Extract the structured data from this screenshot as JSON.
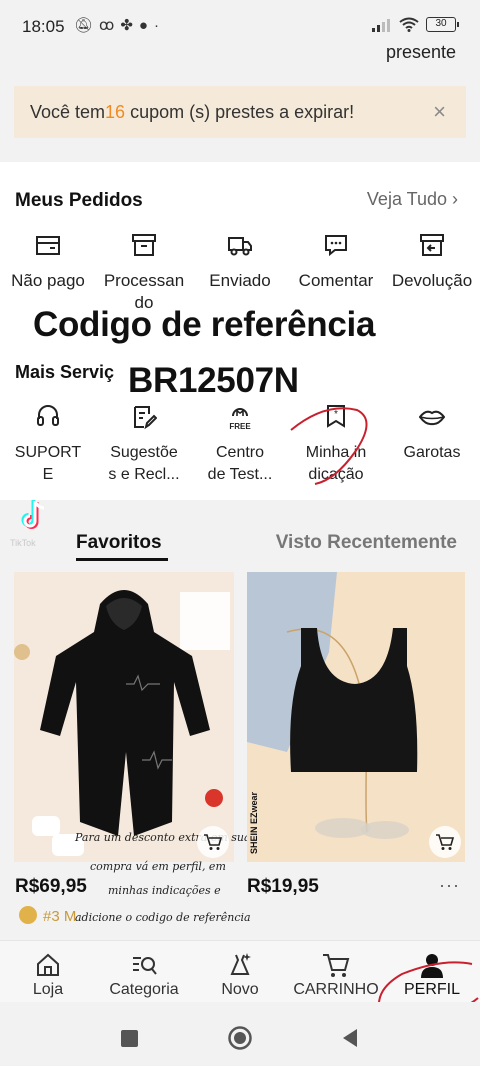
{
  "status_bar": {
    "time": "18:05",
    "icons": [
      "mute-icon",
      "voicemail-icon",
      "pinwheel-icon",
      "check-circle-icon",
      "dot-icon"
    ],
    "battery": "30",
    "top_link": "presente"
  },
  "coupon_banner": {
    "text_before": "Você tem",
    "count": "16",
    "text_after": " cupom (s) prestes a expirar!",
    "close": "×"
  },
  "orders": {
    "title": "Meus Pedidos",
    "see_all": "Veja Tudo",
    "items": [
      {
        "label": "Não pago",
        "icon": "wallet-icon"
      },
      {
        "label": "Processan do",
        "icon": "box-icon"
      },
      {
        "label": "Enviado",
        "icon": "truck-icon"
      },
      {
        "label": "Comentar",
        "icon": "comment-icon"
      },
      {
        "label": "Devolução",
        "icon": "return-icon"
      }
    ]
  },
  "overlay": {
    "code_heading": "Codigo de referência",
    "code": "BR12507N"
  },
  "services": {
    "title": "Mais Serviç",
    "items": [
      {
        "label_l1": "SUPORT",
        "label_l2": "E",
        "icon": "headset-icon"
      },
      {
        "label_l1": "Sugestõe",
        "label_l2": "s e Recl...",
        "icon": "edit-note-icon"
      },
      {
        "label_l1": "Centro",
        "label_l2": "de Test...",
        "icon": "free-trial-icon",
        "icon_text": "FREE"
      },
      {
        "label_l1": "Minha in",
        "label_l2": "dicação",
        "icon": "referral-bookmark-icon"
      },
      {
        "label_l1": "Garotas",
        "label_l2": "",
        "icon": "lips-icon"
      }
    ]
  },
  "tabs": {
    "favorites": "Favoritos",
    "recent": "Visto Recentemente",
    "watermark": "TikTok"
  },
  "products": [
    {
      "price": "R$69,95",
      "image": "black-baby-jumpsuit"
    },
    {
      "price": "R$19,95",
      "image": "black-crop-tank-top",
      "brand": "SHEIN EZwear"
    }
  ],
  "rank_badge": "#3 M",
  "handwritten": {
    "line1": "Para um desconto extra em sua",
    "line2": "compra vá em perfil, em",
    "line3": "minhas indicações e",
    "line4": "adicione o codigo de referência"
  },
  "bottom_nav": [
    {
      "label": "Loja",
      "icon": "home-icon"
    },
    {
      "label": "Categoria",
      "icon": "category-search-icon"
    },
    {
      "label": "Novo",
      "icon": "new-dress-icon"
    },
    {
      "label": "CARRINHO",
      "icon": "cart-icon"
    },
    {
      "label": "PERFIL",
      "icon": "person-icon"
    }
  ],
  "colors": {
    "accent_orange": "#f08a24",
    "annotation_red": "#c8202e",
    "coupon_bg": "#f5ead9"
  }
}
